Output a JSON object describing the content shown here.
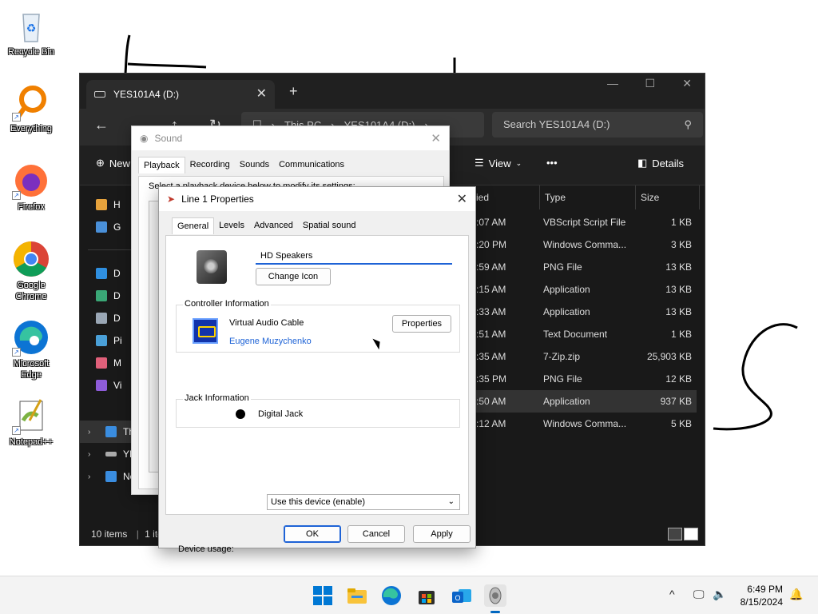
{
  "desktop": {
    "icons": [
      {
        "label": "Recycle Bin"
      },
      {
        "label": "Everything"
      },
      {
        "label": "Firefox"
      },
      {
        "label": "Google Chrome"
      },
      {
        "label": "Microsoft Edge"
      },
      {
        "label": "Notepad++"
      }
    ]
  },
  "explorer": {
    "tab_title": "YES101A4 (D:)",
    "breadcrumb": [
      "This PC",
      "YES101A4 (D:)"
    ],
    "search_placeholder": "Search YES101A4 (D:)",
    "toolbar": {
      "new": "New",
      "view": "View",
      "more": "•••",
      "details": "Details"
    },
    "sidebar": [
      {
        "label": "H"
      },
      {
        "label": "G"
      },
      {
        "label": "D"
      },
      {
        "label": "D"
      },
      {
        "label": "D"
      },
      {
        "label": "Pi"
      },
      {
        "label": "M"
      },
      {
        "label": "Vi"
      },
      {
        "label": "Th"
      },
      {
        "label": "YE"
      },
      {
        "label": "Network"
      }
    ],
    "columns": {
      "date": "ied",
      "type": "Type",
      "size": "Size"
    },
    "rows": [
      {
        "date": ":07 AM",
        "type": "VBScript Script File",
        "size": "1 KB"
      },
      {
        "date": ":20 PM",
        "type": "Windows Comma...",
        "size": "3 KB"
      },
      {
        "date": ":59 AM",
        "type": "PNG File",
        "size": "13 KB"
      },
      {
        "date": ":15 AM",
        "type": "Application",
        "size": "13 KB"
      },
      {
        "date": ":33 AM",
        "type": "Application",
        "size": "13 KB"
      },
      {
        "date": ":51 AM",
        "type": "Text Document",
        "size": "1 KB"
      },
      {
        "date": ":35 AM",
        "type": "7-Zip.zip",
        "size": "25,903 KB"
      },
      {
        "date": ":35 PM",
        "type": "PNG File",
        "size": "12 KB"
      },
      {
        "date": ":50 AM",
        "type": "Application",
        "size": "937 KB"
      },
      {
        "date": ":12 AM",
        "type": "Windows Comma...",
        "size": "5 KB"
      }
    ],
    "status": {
      "items": "10 items",
      "selected": "1 ite"
    }
  },
  "sound": {
    "title": "Sound",
    "tabs": [
      "Playback",
      "Recording",
      "Sounds",
      "Communications"
    ],
    "hint": "Select a playback device below to modify its settings:"
  },
  "props": {
    "title": "Line 1 Properties",
    "tabs": [
      "General",
      "Levels",
      "Advanced",
      "Spatial sound"
    ],
    "device_name": "HD Speakers",
    "change_icon": "Change Icon",
    "controller_legend": "Controller Information",
    "controller_name": "Virtual Audio Cable",
    "controller_vendor": "Eugene Muzychenko",
    "properties_btn": "Properties",
    "jack_legend": "Jack Information",
    "jack_name": "Digital Jack",
    "device_usage_label": "Device usage:",
    "device_usage_value": "Use this device (enable)",
    "ok": "OK",
    "cancel": "Cancel",
    "apply": "Apply"
  },
  "taskbar": {
    "time": "6:49 PM",
    "date": "8/15/2024"
  }
}
